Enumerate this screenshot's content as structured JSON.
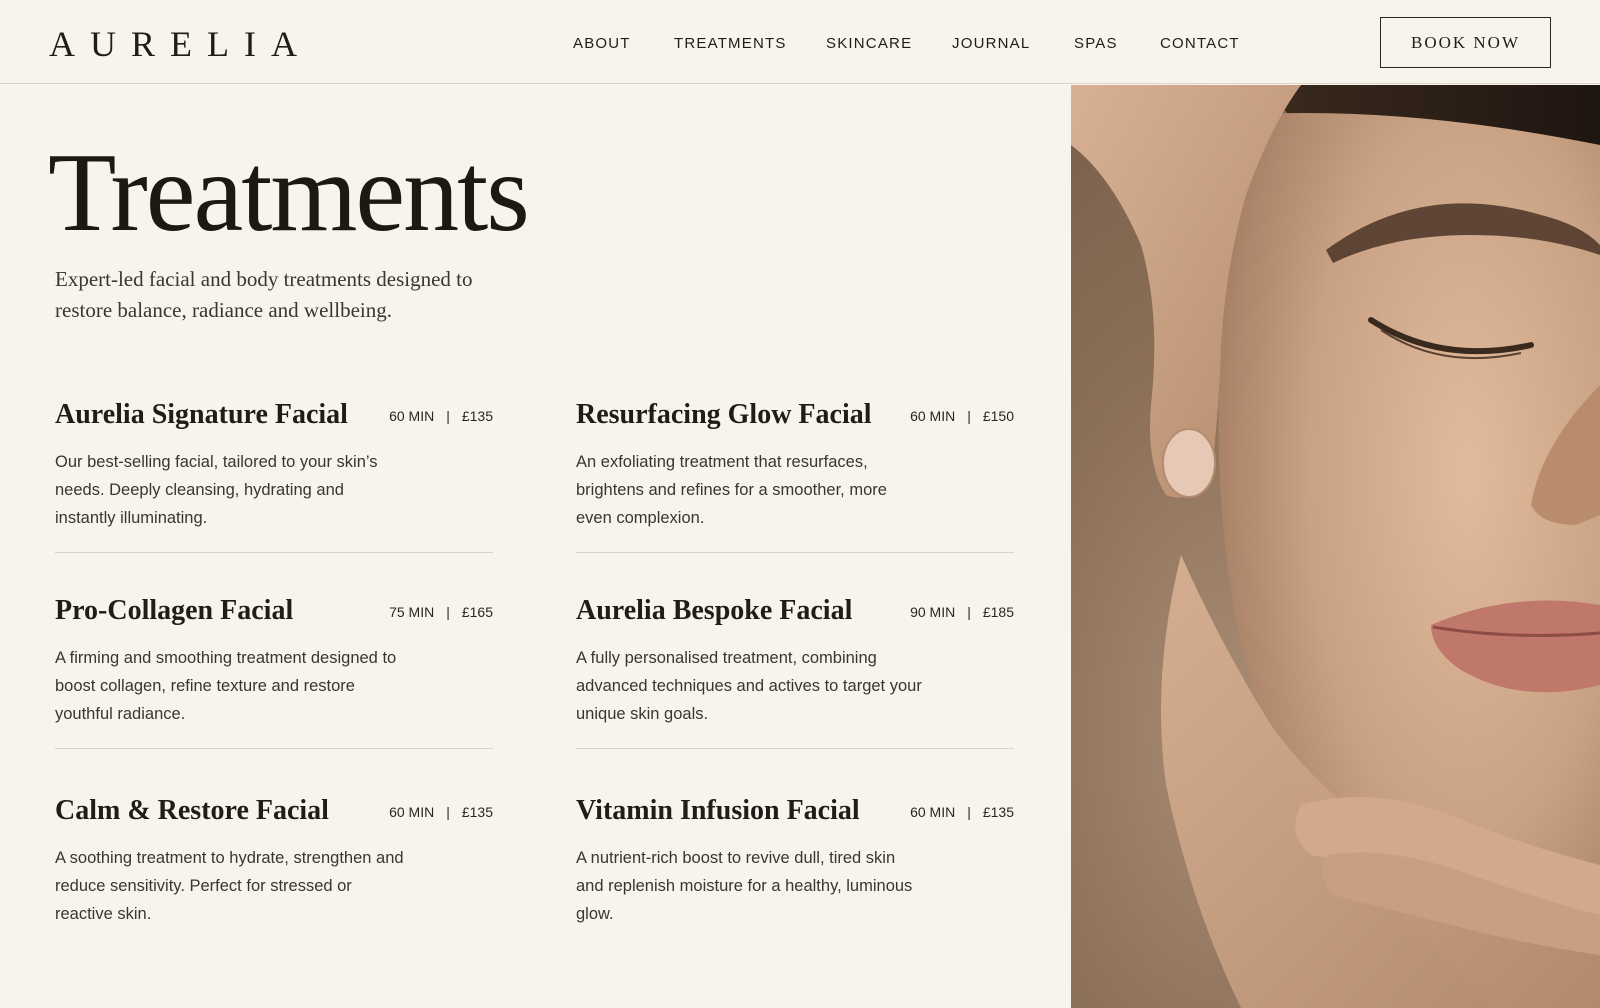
{
  "brand": {
    "logo": "AURELIA"
  },
  "nav": {
    "items": [
      "ABOUT",
      "TREATMENTS",
      "SKINCARE",
      "JOURNAL",
      "SPAS",
      "CONTACT"
    ],
    "book_label": "BOOK NOW"
  },
  "hero": {
    "title": "Treatments",
    "intro": "Expert-led facial and body treatments designed to restore balance, radiance and wellbeing."
  },
  "treatments": [
    {
      "name": "Aurelia Signature Facial",
      "duration": "60 MIN",
      "price": "£135",
      "description": "Our best-selling facial, tailored to your skin’s needs. Deeply cleansing, hydrating and instantly illuminating."
    },
    {
      "name": "Resurfacing Glow Facial",
      "duration": "60 MIN",
      "price": "£150",
      "description": "An exfoliating treatment that resurfaces, brightens and refines for a smoother, more even complexion."
    },
    {
      "name": "Pro-Collagen Facial",
      "duration": "75 MIN",
      "price": "£165",
      "description": "A firming and smoothing treatment designed to boost collagen, refine texture and restore youthful radiance."
    },
    {
      "name": "Aurelia Bespoke Facial",
      "duration": "90 MIN",
      "price": "£185",
      "description": "A fully personalised treatment, combining advanced techniques and actives to target your unique skin goals."
    },
    {
      "name": "Calm & Restore Facial",
      "duration": "60 MIN",
      "price": "£135",
      "description": "A soothing treatment to hydrate, strengthen and reduce sensitivity. Perfect for stressed or reactive skin."
    },
    {
      "name": "Vitamin Infusion Facial",
      "duration": "60 MIN",
      "price": "£135",
      "description": "A nutrient-rich boost to revive dull, tired skin and replenish moisture for a healthy, luminous glow."
    }
  ],
  "meta_separator": "|",
  "colors": {
    "background": "#f8f4ec",
    "text": "#1f1c19",
    "divider": "#d9d3c8",
    "skin": "#c9a184"
  }
}
